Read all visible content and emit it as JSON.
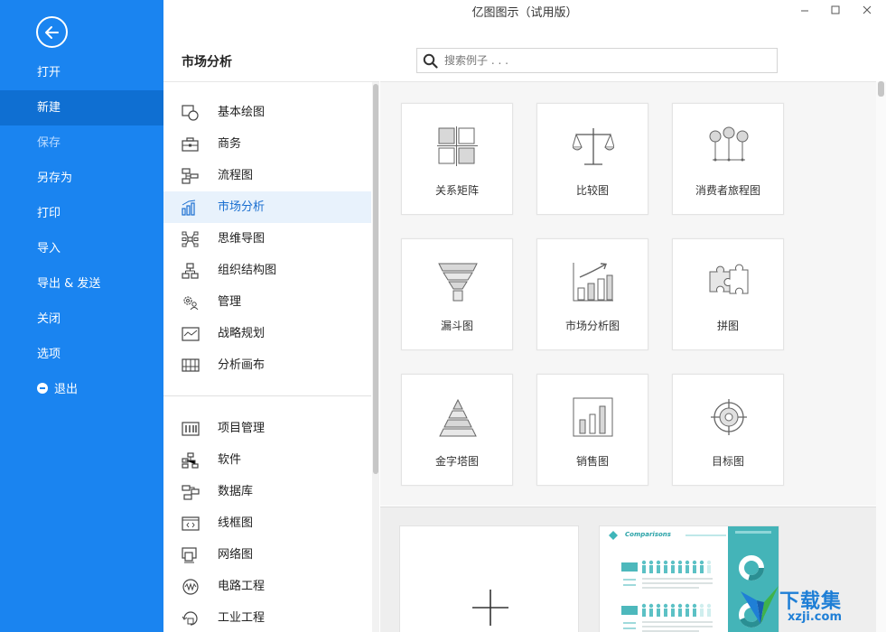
{
  "window": {
    "title": "亿图图示（试用版）"
  },
  "sidebar": {
    "items": [
      {
        "label": "打开"
      },
      {
        "label": "新建"
      },
      {
        "label": "保存"
      },
      {
        "label": "另存为"
      },
      {
        "label": "打印"
      },
      {
        "label": "导入"
      },
      {
        "label": "导出 & 发送"
      },
      {
        "label": "关闭"
      },
      {
        "label": "选项"
      },
      {
        "label": "退出"
      }
    ],
    "active": "新建",
    "colors": {
      "background": "#1a84f0",
      "active": "#0f6fd2"
    }
  },
  "section": {
    "title": "市场分析"
  },
  "search": {
    "placeholder": "搜索例子 . . ."
  },
  "categories": {
    "group1": [
      {
        "label": "基本绘图",
        "icon": "basic-shapes-icon"
      },
      {
        "label": "商务",
        "icon": "briefcase-icon"
      },
      {
        "label": "流程图",
        "icon": "flowchart-icon"
      },
      {
        "label": "市场分析",
        "icon": "bar-chart-icon"
      },
      {
        "label": "思维导图",
        "icon": "mindmap-icon"
      },
      {
        "label": "组织结构图",
        "icon": "org-chart-icon"
      },
      {
        "label": "管理",
        "icon": "gear-people-icon"
      },
      {
        "label": "战略规划",
        "icon": "trend-line-icon"
      },
      {
        "label": "分析画布",
        "icon": "canvas-icon"
      }
    ],
    "group2": [
      {
        "label": "项目管理",
        "icon": "project-icon"
      },
      {
        "label": "软件",
        "icon": "software-icon"
      },
      {
        "label": "数据库",
        "icon": "database-icon"
      },
      {
        "label": "线框图",
        "icon": "wireframe-icon"
      },
      {
        "label": "网络图",
        "icon": "network-icon"
      },
      {
        "label": "电路工程",
        "icon": "circuit-icon"
      },
      {
        "label": "工业工程",
        "icon": "industrial-icon"
      }
    ],
    "active": "市场分析"
  },
  "templates": [
    {
      "label": "关系矩阵",
      "icon": "matrix-icon"
    },
    {
      "label": "比较图",
      "icon": "scale-icon"
    },
    {
      "label": "消费者旅程图",
      "icon": "journey-icon"
    },
    {
      "label": "漏斗图",
      "icon": "funnel-icon"
    },
    {
      "label": "市场分析图",
      "icon": "market-chart-icon"
    },
    {
      "label": "拼图",
      "icon": "puzzle-icon"
    },
    {
      "label": "金字塔图",
      "icon": "pyramid-icon"
    },
    {
      "label": "销售图",
      "icon": "sales-chart-icon"
    },
    {
      "label": "目标图",
      "icon": "target-icon"
    }
  ],
  "bottom": {
    "comparison_title": "Comparisons"
  },
  "watermark": {
    "line1": "下载集",
    "line2": "xzji.com"
  }
}
